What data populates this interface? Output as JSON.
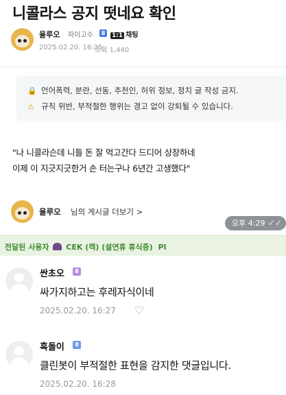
{
  "post": {
    "title": "니콜라스 공지 떳네요 확인",
    "author": {
      "name": "율루오",
      "role": "파이고수",
      "level_badge": "8",
      "chat_icon": "1:1",
      "chat_label": "채팅"
    },
    "date": "2025.02.20. 16:25",
    "views": "조회 1,440",
    "notice": {
      "line1_icon": "lock-icon",
      "line1": "언어폭력, 분란, 선동, 추천인, 허위 정보, 정치 글 작성 금지.",
      "line2_icon": "warning-icon",
      "line2": "규칙 위반, 부적절한 행위는 경고 없이 강퇴될 수 있습니다."
    },
    "body": {
      "line1": "\"나 니콜라슨데 니들 돈 잘 먹고간다 드디어 상장하네",
      "line2": "이제 이 지긋지긋한거 손 터는구나 6년간 고생했다\""
    },
    "more": {
      "author": "율루오",
      "link": "님의 게시글 더보기 >"
    }
  },
  "message": {
    "time": "오후 4:29",
    "status_icon": "double-check-icon"
  },
  "forwarded": {
    "label": "전달된 사용자",
    "user": "CEK (캑) (설연휴 휴식중)",
    "suffix": "PI"
  },
  "comments": [
    {
      "name": "싼초오",
      "badge": "8",
      "text": "싸가지하고는 후레자식이네",
      "date": "2025.02.20. 16:27",
      "like_icon": "heart-icon"
    },
    {
      "name": "흑돌이",
      "badge": "8",
      "text": "클린봇이 부적절한 표현을 감지한 댓글입니다.",
      "date": "2025.02.20. 16:28"
    }
  ],
  "colors": {
    "forward_bg": "#eaf3e3",
    "forward_text": "#3f8a2e",
    "bubble_bg": "#8e9196",
    "notice_bg": "#f5f6f8"
  }
}
